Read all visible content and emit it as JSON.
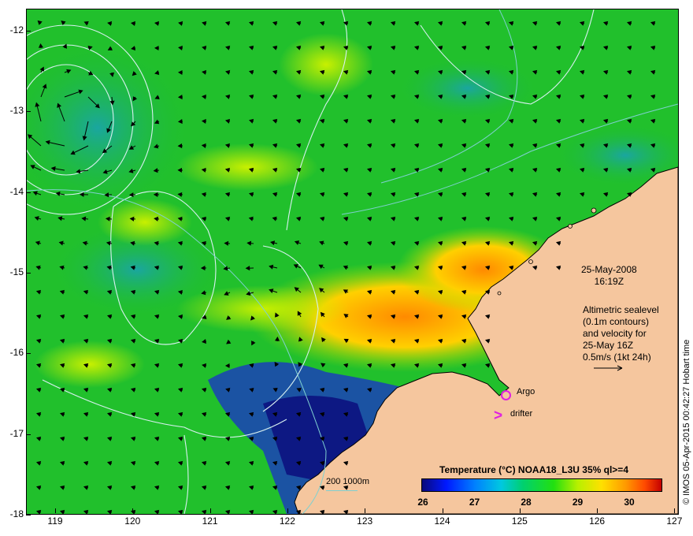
{
  "map": {
    "yticks": [
      "-12",
      "-13",
      "-14",
      "-15",
      "-16",
      "-17",
      "-18"
    ],
    "xticks": [
      "119",
      "120",
      "121",
      "122",
      "123",
      "124",
      "125",
      "126",
      "127"
    ],
    "date_line1": "25-May-2008",
    "date_line2": "16:19Z",
    "alti_lines": [
      "Altimetric sealevel",
      "(0.1m contours)",
      "and velocity for",
      "25-May 16Z",
      "0.5m/s (1kt 24h)"
    ],
    "credit": "© IMOS 05-Apr-2015 00:42:27 Hobart time",
    "colorbar_title": "Temperature (°C) NOAA18_L3U 35% ql>=4",
    "colorbar_labels": [
      "26",
      "27",
      "28",
      "29",
      "30"
    ],
    "bathy_label": "200  1000m",
    "argo_label": "Argo",
    "drifter_label": "drifter",
    "drifter_glyph": ">",
    "colors": {
      "land": "#f5c69e",
      "ocean_warm": "#ff9a00",
      "ocean_mid": "#1fbf2a",
      "ocean_cool": "#00b0d0",
      "ocean_cold": "#0a0a7a",
      "contour": "#d8f0f0",
      "marker": "#e020e0"
    }
  }
}
